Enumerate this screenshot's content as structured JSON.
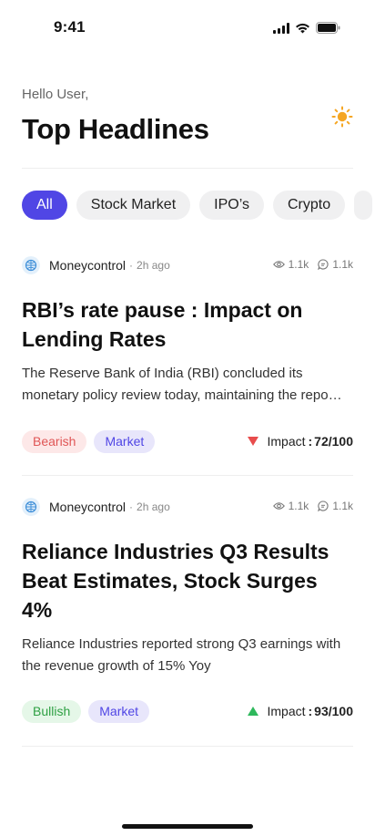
{
  "status_bar": {
    "time": "9:41",
    "icons": [
      "signal-icon",
      "wifi-icon",
      "battery-icon"
    ]
  },
  "header": {
    "greeting": "Hello User,",
    "title": "Top Headlines",
    "theme_icon": "sun-icon"
  },
  "filters": [
    {
      "label": "All",
      "active": true
    },
    {
      "label": "Stock Market",
      "active": false
    },
    {
      "label": "IPO’s",
      "active": false
    },
    {
      "label": "Crypto",
      "active": false
    }
  ],
  "articles": [
    {
      "source": "Moneycontrol",
      "separator": "·",
      "time_ago": "2h ago",
      "views": "1.1k",
      "comments": "1.1k",
      "headline": "RBI’s rate pause : Impact on Lending Rates",
      "summary": "The Reserve Bank of India (RBI) concluded its monetary policy review today, maintaining the repo rate unchanged.",
      "sentiment_tag": "Bearish",
      "category_tag": "Market",
      "impact_label": "Impact",
      "impact_colon": ":",
      "impact_score": "72/100",
      "impact_direction": "down"
    },
    {
      "source": "Moneycontrol",
      "separator": "·",
      "time_ago": "2h ago",
      "views": "1.1k",
      "comments": "1.1k",
      "headline": "Reliance Industries Q3 Results Beat Estimates, Stock Surges 4%",
      "summary": "Reliance Industries reported strong Q3 earnings with the revenue growth of 15% Yoy",
      "sentiment_tag": "Bullish",
      "category_tag": "Market",
      "impact_label": "Impact",
      "impact_colon": ":",
      "impact_score": "93/100",
      "impact_direction": "up"
    }
  ],
  "colors": {
    "accent": "#5046e5",
    "bearish": "#e84d4d",
    "bullish": "#2eb85c",
    "sun": "#f5a623"
  }
}
